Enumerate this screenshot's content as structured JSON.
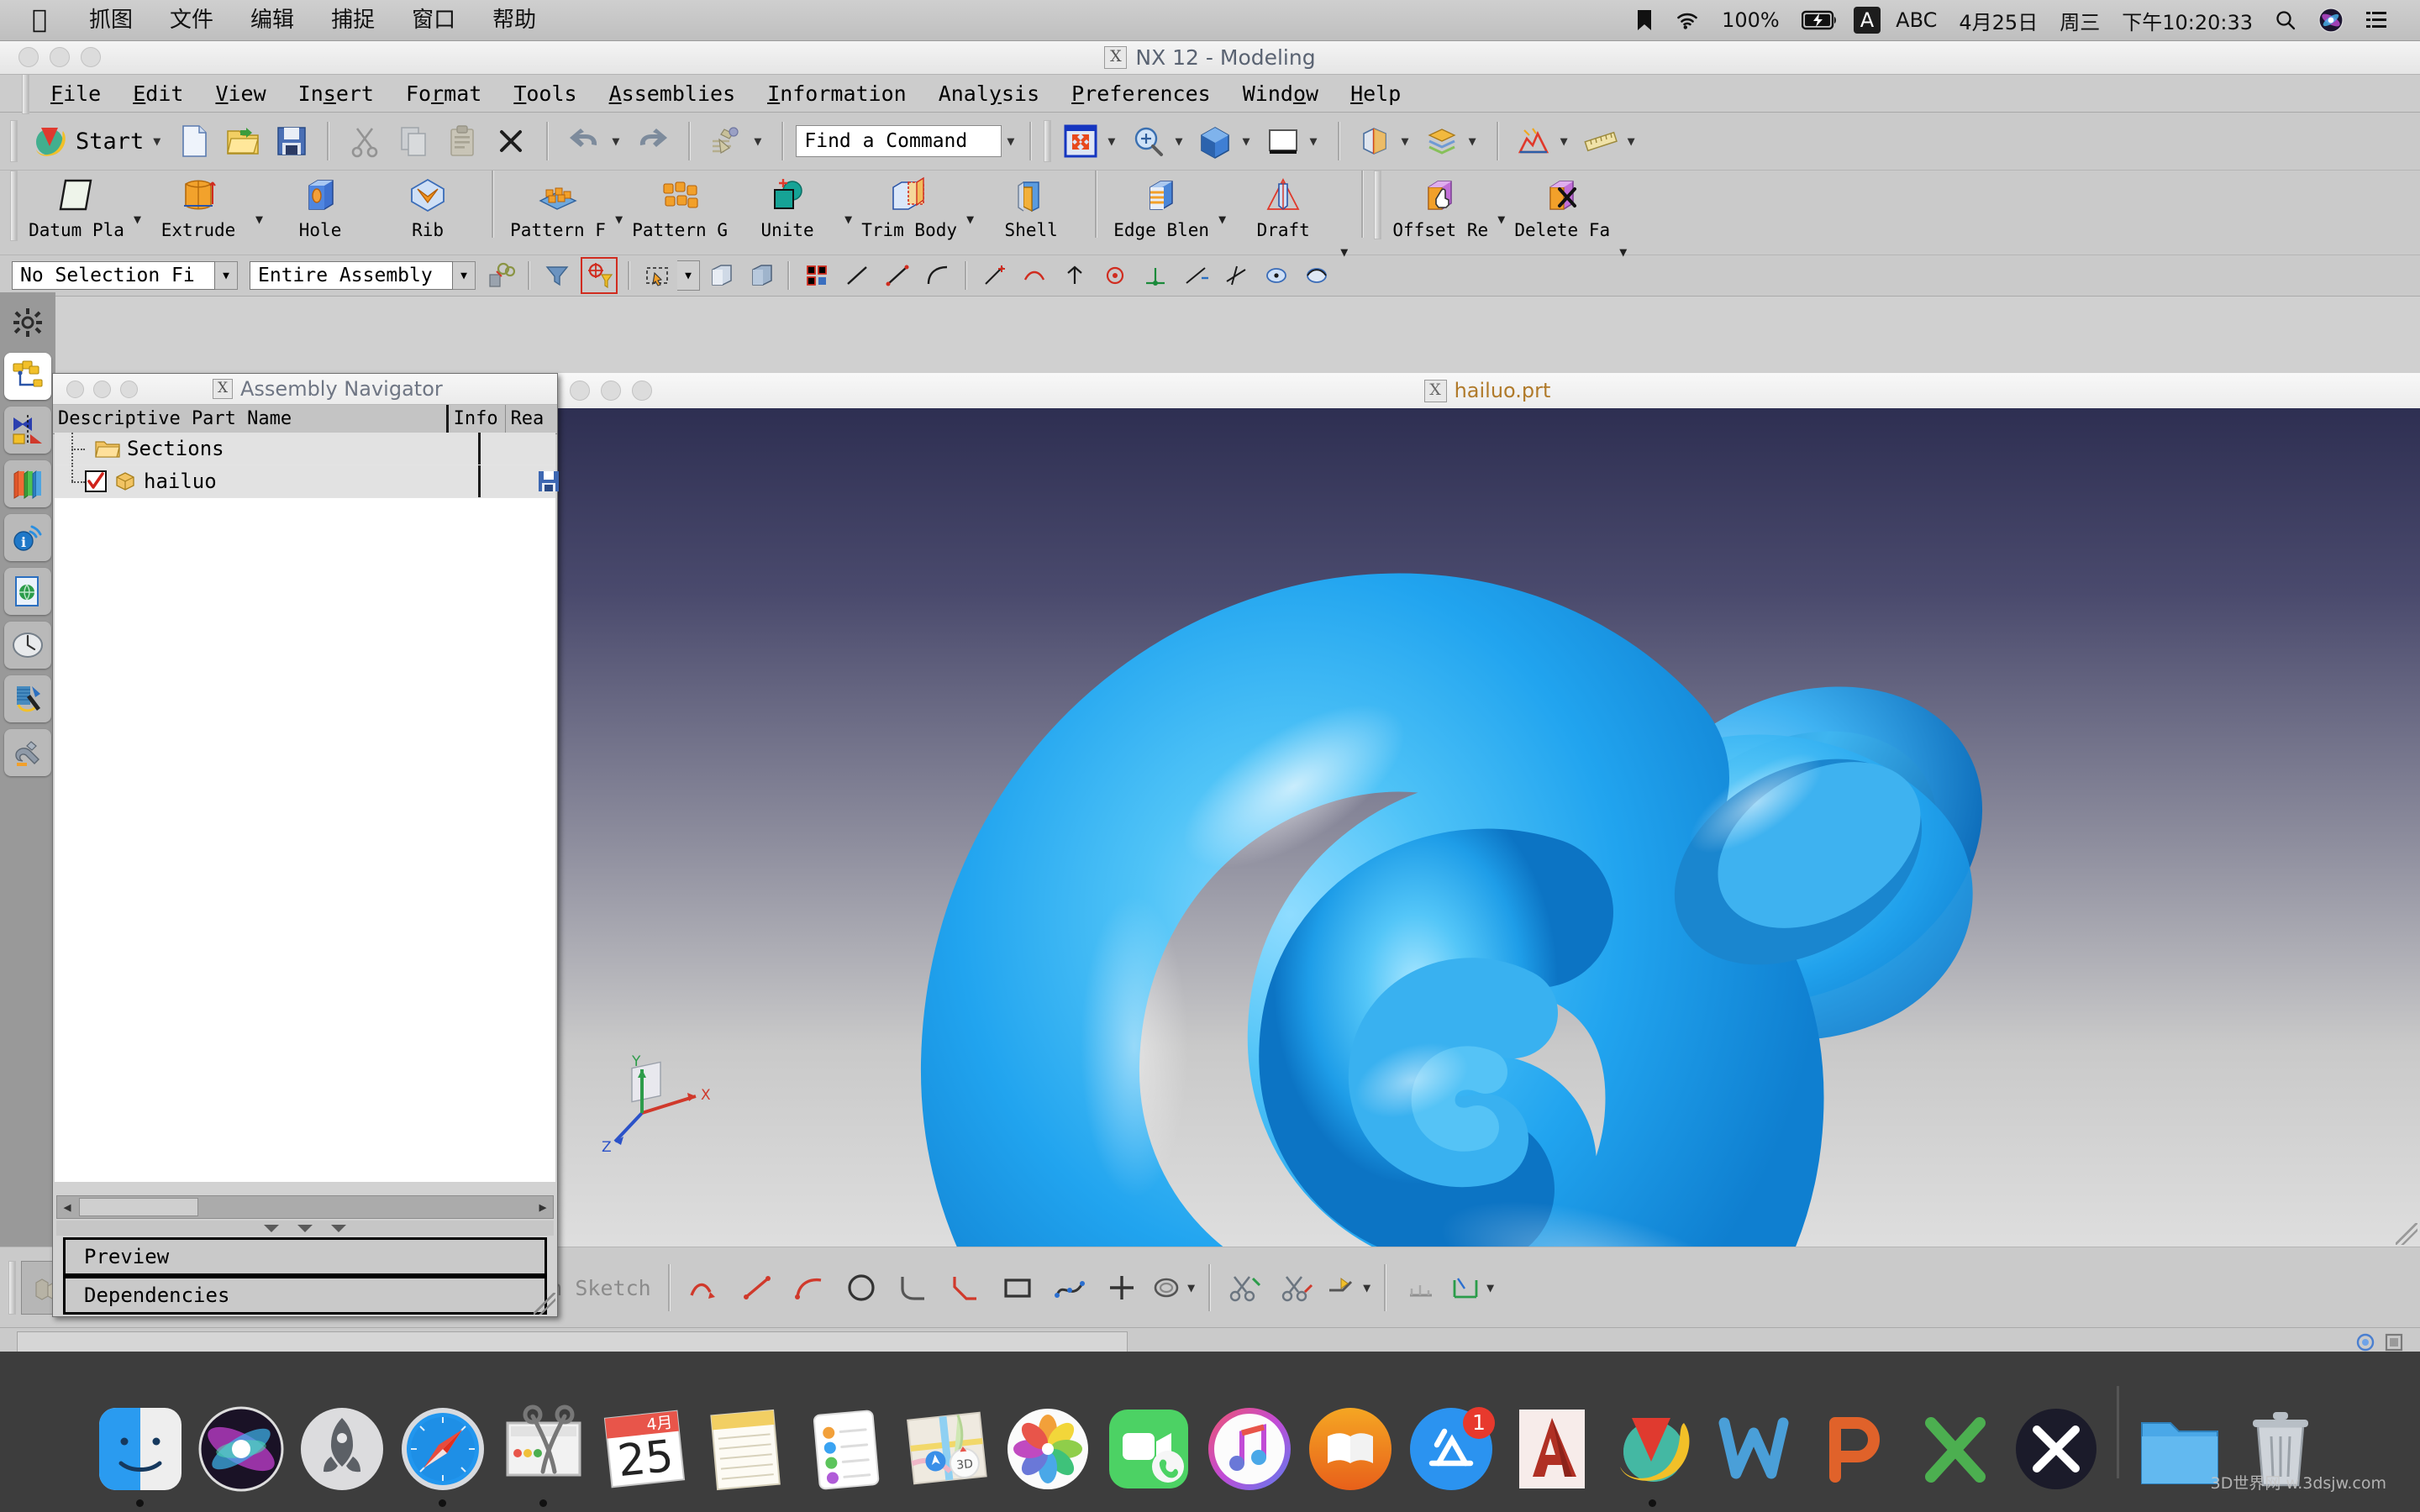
{
  "mac_menubar": {
    "apple_icon": "apple-icon",
    "items": [
      "抓图",
      "文件",
      "编辑",
      "捕捉",
      "窗口",
      "帮助"
    ],
    "status": {
      "dropbox_icon": "folder-icon",
      "wifi_icon": "wifi-icon",
      "battery_percent": "100%",
      "battery_icon": "battery-charging-icon",
      "input_badge": "A",
      "input_method": "ABC",
      "date": "4月25日",
      "weekday": "周三",
      "time": "下午10:20:33",
      "search_icon": "search-icon",
      "siri_icon": "siri-icon",
      "control_center_icon": "list-icon"
    }
  },
  "nx_window": {
    "title": "NX 12 - Modeling",
    "app_icon": "nx-x-icon",
    "menubar": [
      {
        "label": "File",
        "mnemonic": "F"
      },
      {
        "label": "Edit",
        "mnemonic": "E"
      },
      {
        "label": "View",
        "mnemonic": "V"
      },
      {
        "label": "Insert",
        "mnemonic": "I"
      },
      {
        "label": "Format",
        "mnemonic": "r"
      },
      {
        "label": "Tools",
        "mnemonic": "T"
      },
      {
        "label": "Assemblies",
        "mnemonic": "A"
      },
      {
        "label": "Information",
        "mnemonic": "I"
      },
      {
        "label": "Analysis",
        "mnemonic": "y"
      },
      {
        "label": "Preferences",
        "mnemonic": "P"
      },
      {
        "label": "Window",
        "mnemonic": "o"
      },
      {
        "label": "Help",
        "mnemonic": "H"
      }
    ],
    "quick_toolbar": {
      "start_label": "Start",
      "start_icon": "nx-start-icon",
      "new_icon": "new-file-icon",
      "open_icon": "open-folder-icon",
      "save_icon": "save-floppy-icon",
      "cut_icon": "cut-scissors-icon",
      "copy_icon": "copy-icon",
      "paste_icon": "paste-clipboard-icon",
      "delete_icon": "delete-x-icon",
      "undo_icon": "undo-icon",
      "redo_icon": "redo-icon",
      "move_object_icon": "move-object-icon",
      "find_command_placeholder": "Find a Command",
      "fit_icon": "fit-view-icon",
      "zoom_icon": "zoom-icon",
      "render_style_icon": "render-style-icon",
      "view_orient_icon": "view-orientation-icon",
      "background_icon": "background-icon",
      "section_icon": "section-icon",
      "layer_icon": "layer-icon",
      "analysis_icon": "analysis-icon",
      "measure_icon": "measure-icon"
    },
    "ribbon": [
      {
        "label": "Datum Pla",
        "icon": "datum-plane-icon",
        "has_caret": true
      },
      {
        "label": "Extrude",
        "icon": "extrude-icon",
        "has_caret": true
      },
      {
        "label": "Hole",
        "icon": "hole-icon",
        "has_caret": false
      },
      {
        "label": "Rib",
        "icon": "rib-icon",
        "has_caret": false
      },
      {
        "label": "Pattern F",
        "icon": "pattern-feature-icon",
        "has_caret": true
      },
      {
        "label": "Pattern G",
        "icon": "pattern-geometry-icon",
        "has_caret": false
      },
      {
        "label": "Unite",
        "icon": "unite-icon",
        "has_caret": true
      },
      {
        "label": "Trim Body",
        "icon": "trim-body-icon",
        "has_caret": true
      },
      {
        "label": "Shell",
        "icon": "shell-icon",
        "has_caret": false
      },
      {
        "label": "Edge Blen",
        "icon": "edge-blend-icon",
        "has_caret": true
      },
      {
        "label": "Draft",
        "icon": "draft-icon",
        "has_caret": true
      },
      {
        "label": "Offset Re",
        "icon": "offset-region-icon",
        "has_caret": true
      },
      {
        "label": "Delete Fa",
        "icon": "delete-face-icon",
        "has_caret": true
      }
    ],
    "selection_bar": {
      "filter_value": "No Selection Fi",
      "scope_value": "Entire Assembly",
      "icons": [
        "select-general-icon",
        "filter-icon",
        "snap-point-icon",
        "box-select-icon",
        "face-select-icon",
        "body-select-icon",
        "snap-grid-icon",
        "line-icon",
        "arc-icon",
        "spline-icon",
        "curve-icon",
        "existing-point-icon",
        "end-point-icon",
        "midpoint-icon",
        "center-icon",
        "quadrant-icon",
        "intersection-icon",
        "tangent-icon",
        "face-point-icon"
      ]
    },
    "resource_bar": [
      {
        "icon": "gear-icon",
        "selected": false,
        "plain": true
      },
      {
        "icon": "assembly-navigator-icon",
        "selected": true,
        "plain": false
      },
      {
        "icon": "constraint-navigator-icon",
        "selected": false,
        "plain": false
      },
      {
        "icon": "part-navigator-icon",
        "selected": false,
        "plain": false
      },
      {
        "icon": "reuse-library-icon",
        "selected": false,
        "plain": false
      },
      {
        "icon": "html-help-icon",
        "selected": false,
        "plain": false
      },
      {
        "icon": "history-icon",
        "selected": false,
        "plain": false
      },
      {
        "icon": "sheet-body-icon",
        "selected": false,
        "plain": false
      },
      {
        "icon": "roles-icon",
        "selected": false,
        "plain": false
      }
    ]
  },
  "assembly_navigator": {
    "title": "Assembly Navigator",
    "icon": "nx-x-icon",
    "columns": [
      "Descriptive Part Name",
      "Info",
      "Rea"
    ],
    "rows": [
      {
        "name": "Sections",
        "icon": "folder-icon",
        "has_checkbox": false,
        "checked": false,
        "read_icon": ""
      },
      {
        "name": "hailuo",
        "icon": "part-box-icon",
        "has_checkbox": true,
        "checked": true,
        "read_icon": "save-floppy-icon"
      }
    ],
    "buttons": [
      "Preview",
      "Dependencies"
    ]
  },
  "graphics_window": {
    "tab_name": "hailuo.prt",
    "tab_icon": "nx-x-icon",
    "model_name": "hailuo",
    "model_color": "#2fa8ef",
    "background_top": "#2e2f52",
    "background_bottom": "#dedede",
    "triad": {
      "x_label": "X",
      "y_label": "Y",
      "z_label": "Z"
    }
  },
  "bottom_toolbar": {
    "finish_sketch_label": "Finish Sketch",
    "icons": [
      "hide-icon",
      "show-add-icon",
      "move-face-icon",
      "mirror-icon",
      "pair-icon",
      "show-all-icon",
      "sketch-in-task-icon",
      "finish-flag-icon",
      "profile-icon",
      "line-icon",
      "arc-icon",
      "circle-icon",
      "fillet-icon",
      "rectangle-icon",
      "studio-spline-icon",
      "point-icon",
      "offset-curve-icon",
      "quick-trim-icon",
      "quick-extend-icon",
      "make-corner-icon",
      "geometric-constraint-icon",
      "dimension-icon"
    ]
  },
  "status_bar": {
    "message": "",
    "indicator_left_icon": "status-indicator-icon",
    "indicator_right_icon": "status-indicator-icon"
  },
  "dock": {
    "items": [
      {
        "name": "Finder",
        "icon": "finder-icon",
        "running": true,
        "badge": ""
      },
      {
        "name": "Siri",
        "icon": "siri-icon",
        "running": false,
        "badge": ""
      },
      {
        "name": "Launchpad",
        "icon": "launchpad-icon",
        "running": false,
        "badge": ""
      },
      {
        "name": "Safari",
        "icon": "safari-icon",
        "running": true,
        "badge": ""
      },
      {
        "name": "Grab",
        "icon": "grab-icon",
        "running": true,
        "badge": ""
      },
      {
        "name": "Calendar",
        "icon": "calendar-icon",
        "running": false,
        "badge": "",
        "month": "4月",
        "day": "25"
      },
      {
        "name": "Notes",
        "icon": "notes-icon",
        "running": false,
        "badge": ""
      },
      {
        "name": "Reminders",
        "icon": "reminders-icon",
        "running": false,
        "badge": ""
      },
      {
        "name": "Maps",
        "icon": "maps-icon",
        "running": false,
        "badge": ""
      },
      {
        "name": "Photos",
        "icon": "photos-icon",
        "running": false,
        "badge": ""
      },
      {
        "name": "FaceTime",
        "icon": "facetime-icon",
        "running": false,
        "badge": ""
      },
      {
        "name": "iTunes",
        "icon": "itunes-icon",
        "running": false,
        "badge": ""
      },
      {
        "name": "iBooks",
        "icon": "ibooks-icon",
        "running": false,
        "badge": ""
      },
      {
        "name": "App Store",
        "icon": "appstore-icon",
        "running": false,
        "badge": "1"
      },
      {
        "name": "AutoCAD",
        "icon": "autocad-icon",
        "running": false,
        "badge": ""
      },
      {
        "name": "NX",
        "icon": "nx-icon",
        "running": true,
        "badge": ""
      },
      {
        "name": "Word",
        "icon": "word-icon",
        "running": false,
        "badge": ""
      },
      {
        "name": "PowerPoint",
        "icon": "powerpoint-icon",
        "running": false,
        "badge": ""
      },
      {
        "name": "Excel",
        "icon": "excel-icon",
        "running": false,
        "badge": ""
      },
      {
        "name": "X",
        "icon": "x-app-icon",
        "running": false,
        "badge": ""
      },
      {
        "name": "Downloads",
        "icon": "downloads-folder-icon",
        "running": false,
        "badge": ""
      },
      {
        "name": "Trash",
        "icon": "trash-icon",
        "running": false,
        "badge": ""
      }
    ],
    "watermark": "3D世界网  w.3dsjw.com"
  }
}
